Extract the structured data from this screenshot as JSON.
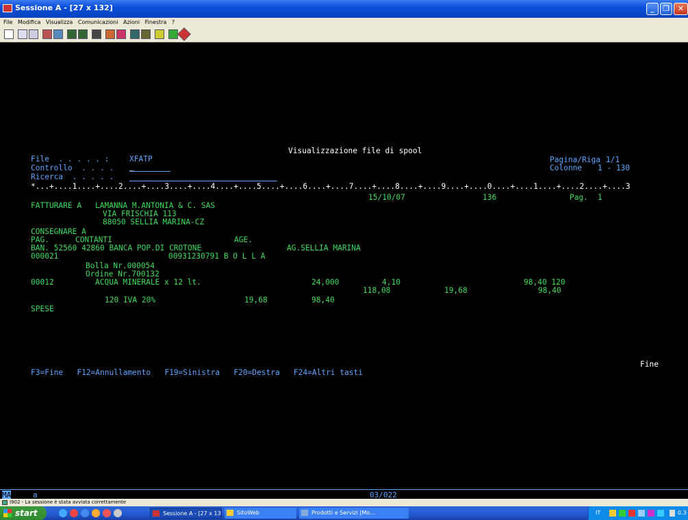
{
  "window": {
    "title": "Sessione A - [27 x 132]"
  },
  "menu": [
    "File",
    "Modifica",
    "Visualizza",
    "Comunicazioni",
    "Azioni",
    "Finestra",
    "?"
  ],
  "spool": {
    "title": "Visualizzazione file di spool",
    "file_label": "File  . . . . . :",
    "file_value": "XFATP",
    "controllo_label": "Controllo  . . . .",
    "controllo_value": "_",
    "ricerca_label": "Ricerca  . . . . .",
    "pagina_label": "Pagina/Riga",
    "pagina_value": "1/1",
    "colonne_label": "Colonne",
    "colonne_value": "1 - 130",
    "ruler": "*...+....1....+....2....+....3....+....4....+....5....+....6....+....7....+....8....+....9....+....0....+....1....+....2....+....3",
    "footer_fine": "Fine",
    "fkeys": "F3=Fine   F12=Annullamento   F19=Sinistra   F20=Destra   F24=Altri tasti"
  },
  "document": {
    "date": "15/10/07",
    "number": "136",
    "pag_label": "Pag.",
    "pag_value": "1",
    "fatturare_label": "FATTURARE A",
    "customer_name": "LAMANNA M.ANTONIA & C. SAS",
    "address1": "VIA FRISCHIA 113",
    "address2": "88050 SELLIA MARINA-CZ",
    "consegnare_label": "CONSEGNARE A",
    "pag_payment_label": "PAG.",
    "payment": "CONTANTI",
    "age_label": "AGE.",
    "bank": "BAN. 52560 42860 BANCA POP.DI CROTONE",
    "agency": "AG.SELLIA MARINA",
    "code": "000021",
    "vat_doc": "00931230791 B O L L A",
    "bolla": "Bolla Nr.000054",
    "ordine": "Ordine Nr.700132",
    "item_code": "00012",
    "item_desc": "ACQUA MINERALE x 12 lt.",
    "qty": "24,000",
    "price": "4,10",
    "line_total": "98,40 120",
    "gross": "118,08",
    "iva_amount": "19,68",
    "net": "98,40",
    "iva_row_label": "120 IVA 20%",
    "iva_row_amount": "19,68",
    "iva_row_base": "98,40",
    "spese": "SPESE"
  },
  "oia": {
    "left": "MA",
    "mode": "a",
    "position": "03/022"
  },
  "status": {
    "message": "I902 - La sessione è stata avviata correttamente"
  },
  "taskbar": {
    "start": "start",
    "tasks": [
      "Sessione A - [27 x 132]",
      "SitoWeb",
      "Prodotti e Servizi [Mo..."
    ],
    "clock": "0.3"
  },
  "colors": {
    "green": "#3edc5a",
    "blue": "#5ca6ff",
    "white": "#ffffff",
    "titlebar": "#0a4fd6"
  }
}
